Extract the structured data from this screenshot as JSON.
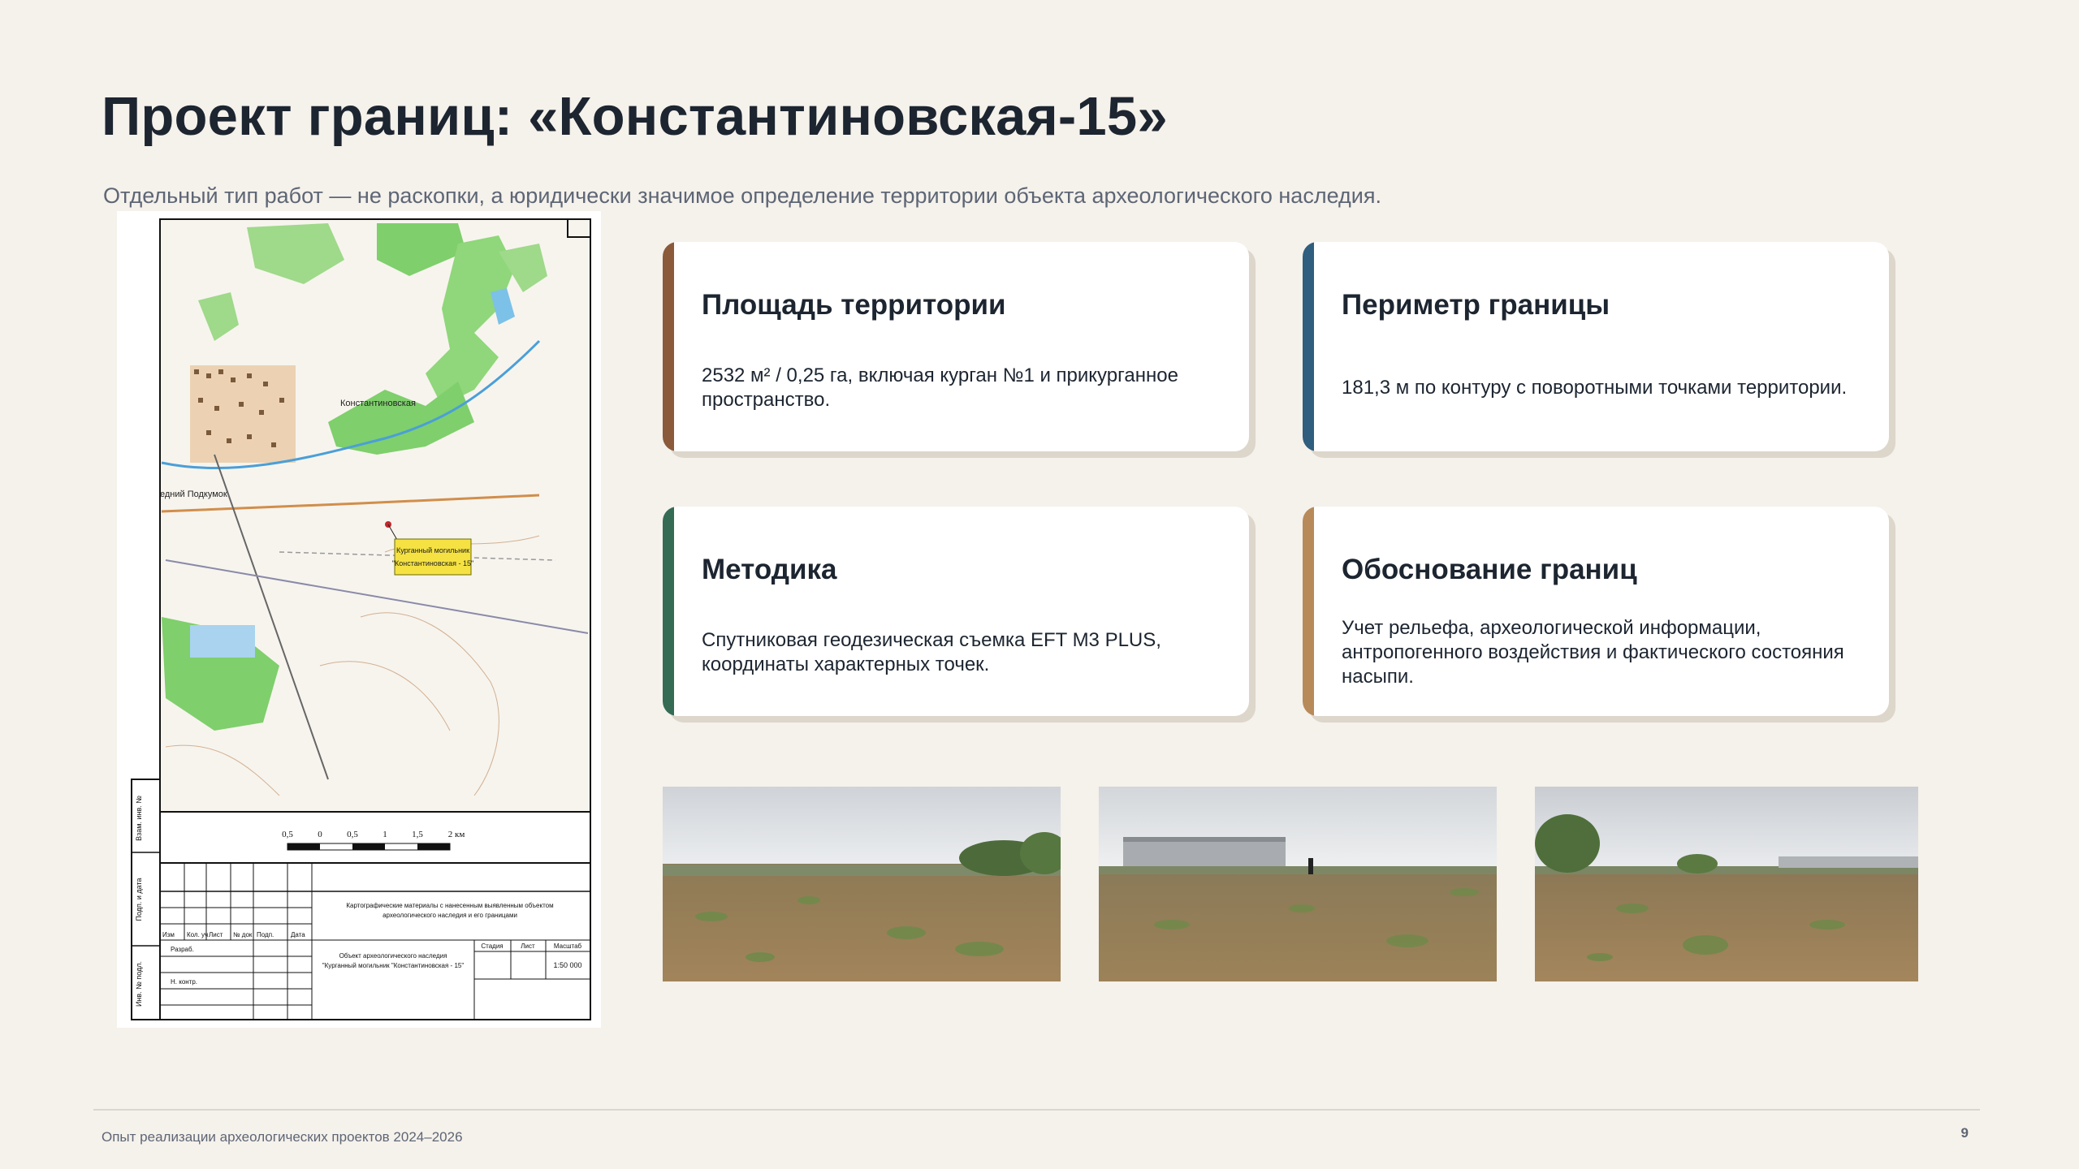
{
  "header": {
    "title": "Проект границ: «Константиновская-15»",
    "subtitle": "Отдельный тип работ — не раскопки, а юридически значимое определение территории объекта археологического наследия."
  },
  "map": {
    "town_label": "Константиновская",
    "village_label": "едний Подкумок",
    "callout_line1": "Курганный могильник",
    "callout_line2": "\"Константиновская - 15\"",
    "scale_labels": [
      "0,5",
      "0",
      "0,5",
      "1",
      "1,5",
      "2 км"
    ],
    "stamp_title_line1": "Картографические материалы с нанесенным выявленным объектом",
    "stamp_title_line2": "археологического наследия и его границами",
    "stamp_object_line1": "Объект археологического наследия",
    "stamp_object_line2": "\"Курганный могильник \"Константиновская - 15\"",
    "stamp_headers": [
      "Изм",
      "Кол. уч",
      "Лист",
      "№ док",
      "Подп.",
      "Дата"
    ],
    "stamp_row1": "Разраб.",
    "stamp_row2": "Н. контр.",
    "stamp_col_stage": "Стадия",
    "stamp_col_sheet": "Лист",
    "stamp_col_scale": "Масштаб",
    "stamp_scale_value": "1:50 000",
    "side_labels": [
      "Взам. инв. №",
      "Подп. и дата",
      "Инв. № подл."
    ]
  },
  "cards": [
    {
      "title": "Площадь территории",
      "text": "2532 м² / 0,25 га, включая курган №1 и прикурганное пространство.",
      "accent": "#8a5a3b"
    },
    {
      "title": "Периметр границы",
      "text": "181,3 м по контуру с поворотными точками территории.",
      "accent": "#2f5e7e"
    },
    {
      "title": "Методика",
      "text": "Спутниковая геодезическая съемка EFT M3 PLUS, координаты характерных точек.",
      "accent": "#356b55"
    },
    {
      "title": "Обоснование границ",
      "text": "Учет рельефа, археологической информации, антропогенного воздействия и фактического состояния насыпи.",
      "accent": "#b88a5a"
    }
  ],
  "footer": {
    "text": "Опыт реализации археологических проектов 2024–2026",
    "page_number": "9"
  }
}
